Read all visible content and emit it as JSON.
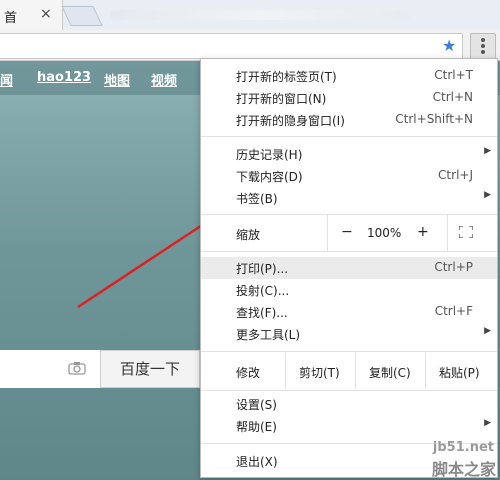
{
  "tabs": {
    "active_title": "首",
    "close": "×"
  },
  "page": {
    "nav_links": [
      "闻",
      "hao123",
      "地图",
      "视频"
    ],
    "search_button": "百度一下"
  },
  "menu": {
    "items_top": [
      {
        "label": "打开新的标签页(T)",
        "shortcut": "Ctrl+T"
      },
      {
        "label": "打开新的窗口(N)",
        "shortcut": "Ctrl+N"
      },
      {
        "label": "打开新的隐身窗口(I)",
        "shortcut": "Ctrl+Shift+N"
      }
    ],
    "items_history": [
      {
        "label": "历史记录(H)",
        "shortcut": ""
      },
      {
        "label": "下载内容(D)",
        "shortcut": "Ctrl+J"
      },
      {
        "label": "书签(B)",
        "shortcut": ""
      }
    ],
    "zoom": {
      "label": "缩放",
      "minus": "−",
      "value": "100%",
      "plus": "+"
    },
    "items_tools": [
      {
        "label": "打印(P)...",
        "shortcut": "Ctrl+P"
      },
      {
        "label": "投射(C)...",
        "shortcut": ""
      },
      {
        "label": "查找(F)...",
        "shortcut": "Ctrl+F"
      },
      {
        "label": "更多工具(L)",
        "shortcut": ""
      }
    ],
    "edit": {
      "label": "修改",
      "cut": "剪切(T)",
      "copy": "复制(C)",
      "paste": "粘贴(P)"
    },
    "items_bottom": [
      {
        "label": "设置(S)",
        "shortcut": ""
      },
      {
        "label": "帮助(E)",
        "shortcut": ""
      }
    ],
    "exit": {
      "label": "退出(X)",
      "shortcut": ""
    }
  },
  "watermark": {
    "site": "jb51.net",
    "name": "脚本之家"
  },
  "colors": {
    "accent": "#3b7ddd",
    "arrow": "#e02020",
    "page_bg": "#7aa1a3"
  }
}
